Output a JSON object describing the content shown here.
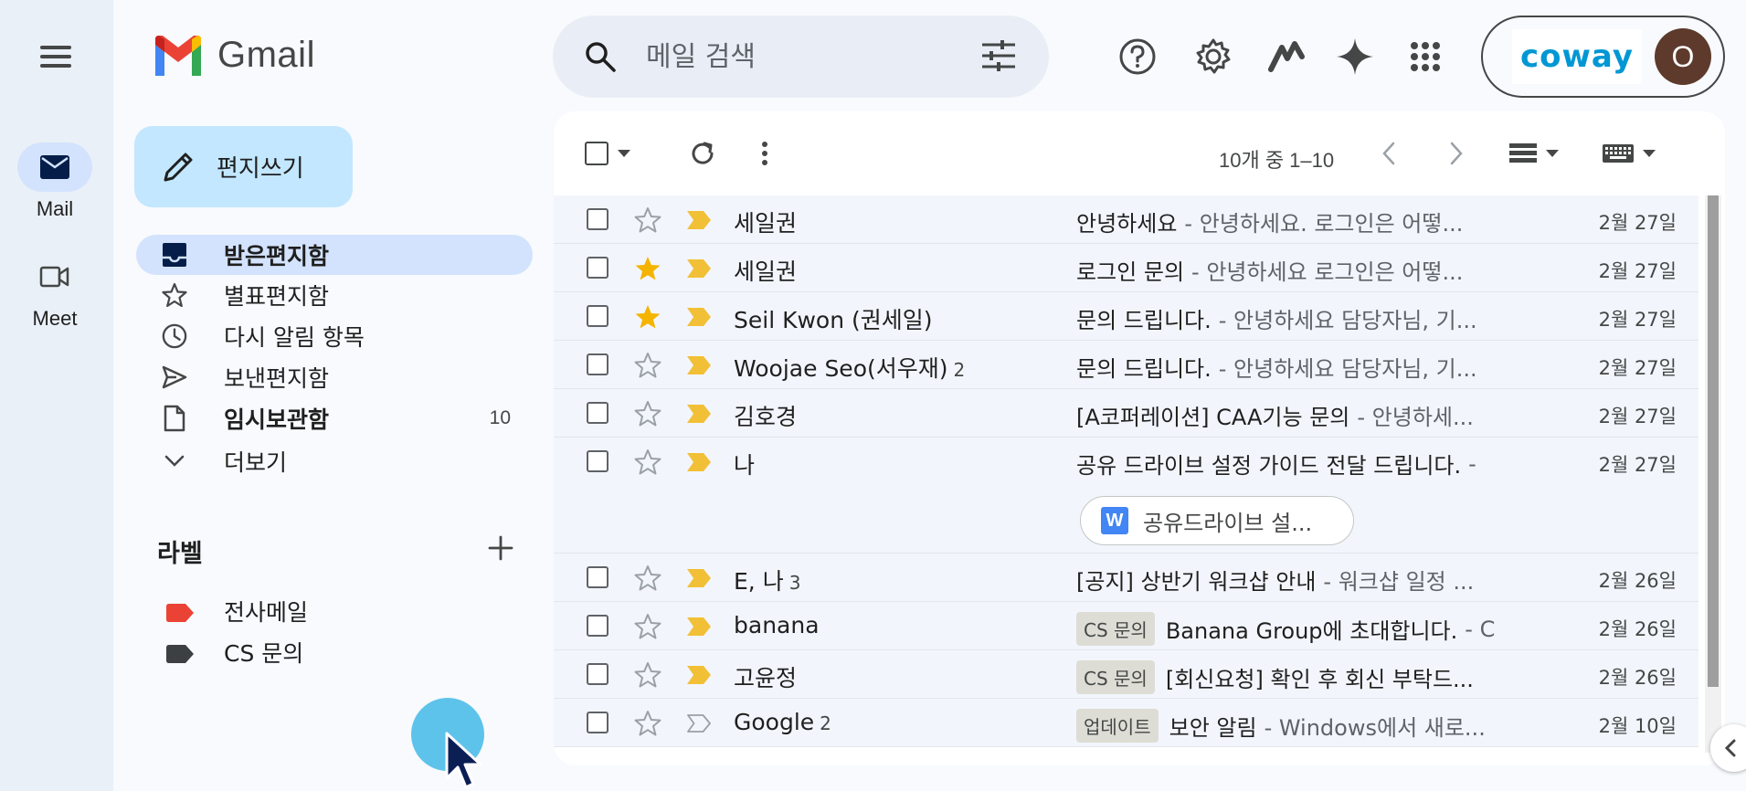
{
  "app": {
    "logo_text": "Gmail"
  },
  "rail": {
    "items": [
      {
        "label": "Mail"
      },
      {
        "label": "Meet"
      }
    ]
  },
  "search": {
    "placeholder": "메일 검색"
  },
  "account": {
    "org_logo": "coway",
    "avatar_letter": "O"
  },
  "compose": {
    "label": "편지쓰기"
  },
  "nav": {
    "items": [
      {
        "label": "받은편지함",
        "count": ""
      },
      {
        "label": "별표편지함",
        "count": ""
      },
      {
        "label": "다시 알림 항목",
        "count": ""
      },
      {
        "label": "보낸편지함",
        "count": ""
      },
      {
        "label": "임시보관함",
        "count": "10"
      },
      {
        "label": "더보기",
        "count": ""
      }
    ]
  },
  "labels": {
    "title": "라벨",
    "items": [
      {
        "name": "전사메일",
        "color": "#ea4335"
      },
      {
        "name": "CS 문의",
        "color": "#3c4043"
      }
    ]
  },
  "toolbar": {
    "pager": "10개 중 1–10"
  },
  "emails": [
    {
      "sender": "세일권",
      "count": "",
      "starred": false,
      "badge": "",
      "subject": "안녕하세요",
      "snippet": "- 안녕하세요. 로그인은 어떻...",
      "date": "2월 27일",
      "important": true
    },
    {
      "sender": "세일권",
      "count": "",
      "starred": true,
      "badge": "",
      "subject": "로그인 문의",
      "snippet": "- 안녕하세요 로그인은 어떻...",
      "date": "2월 27일",
      "important": true
    },
    {
      "sender": "Seil Kwon (권세일)",
      "count": "",
      "starred": true,
      "badge": "",
      "subject": "문의 드립니다.",
      "snippet": "- 안녕하세요 담당자님, 기...",
      "date": "2월 27일",
      "important": true
    },
    {
      "sender": "Woojae Seo(서우재)",
      "count": "2",
      "starred": false,
      "badge": "",
      "subject": "문의 드립니다.",
      "snippet": "- 안녕하세요 담당자님, 기...",
      "date": "2월 27일",
      "important": true
    },
    {
      "sender": "김호경",
      "count": "",
      "starred": false,
      "badge": "",
      "subject": "[A코퍼레이션] CAA기능 문의",
      "snippet": "- 안녕하세...",
      "date": "2월 27일",
      "important": true
    },
    {
      "sender": "나",
      "count": "",
      "starred": false,
      "badge": "",
      "subject": "공유 드라이브 설정 가이드 전달 드립니다.",
      "snippet": "-",
      "date": "2월 27일",
      "important": true,
      "attachment": "공유드라이브 설..."
    },
    {
      "sender": "E, 나",
      "count": "3",
      "starred": false,
      "badge": "",
      "subject": "[공지] 상반기 워크샵 안내",
      "snippet": "- 워크샵 일정 ...",
      "date": "2월 26일",
      "important": true
    },
    {
      "sender": "banana",
      "count": "",
      "starred": false,
      "badge": "CS 문의",
      "subject": "Banana Group에 초대합니다.",
      "snippet": "- C",
      "date": "2월 26일",
      "important": true
    },
    {
      "sender": "고윤정",
      "count": "",
      "starred": false,
      "badge": "CS 문의",
      "subject": "[회신요청] 확인 후 회신 부탁드...",
      "snippet": "",
      "date": "2월 26일",
      "important": true
    },
    {
      "sender": "Google",
      "count": "2",
      "starred": false,
      "badge": "업데이트",
      "subject": "보안 알림",
      "snippet": "- Windows에서 새로...",
      "date": "2월 10일",
      "important": false
    }
  ],
  "colors": {
    "accent": "#0b57d0",
    "important": "#f2c037",
    "star": "#f4b400"
  }
}
